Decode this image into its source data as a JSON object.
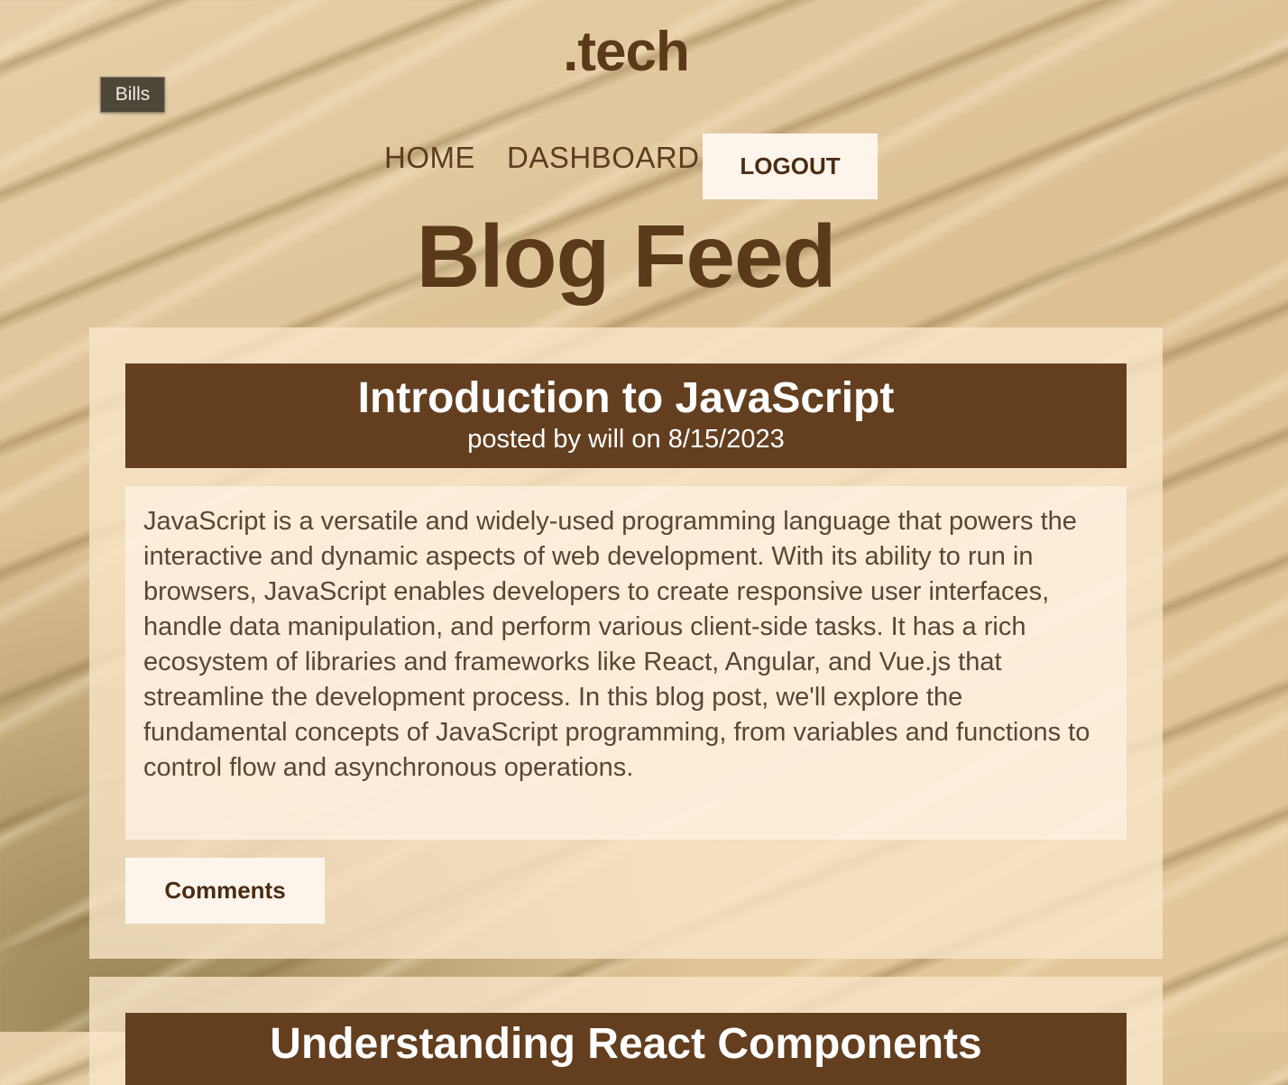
{
  "site": {
    "brand": ".tech",
    "badge": "Bills"
  },
  "nav": {
    "home": "HOME",
    "dashboard": "DASHBOARD",
    "logout": "LOGOUT"
  },
  "page": {
    "title": "Blog Feed"
  },
  "posts": [
    {
      "title": "Introduction to JavaScript",
      "meta": "posted by will on 8/15/2023",
      "body": "JavaScript is a versatile and widely-used programming language that powers the interactive and dynamic aspects of web development. With its ability to run in browsers, JavaScript enables developers to create responsive user interfaces, handle data manipulation, and perform various client-side tasks. It has a rich ecosystem of libraries and frameworks like React, Angular, and Vue.js that streamline the development process. In this blog post, we'll explore the fundamental concepts of JavaScript programming, from variables and functions to control flow and asynchronous operations.",
      "comments_label": "Comments"
    },
    {
      "title": "Understanding React Components"
    }
  ],
  "colors": {
    "brand_brown": "#5b3a1a",
    "header_brown": "#633f20",
    "button_bg": "#fdf5ec"
  }
}
